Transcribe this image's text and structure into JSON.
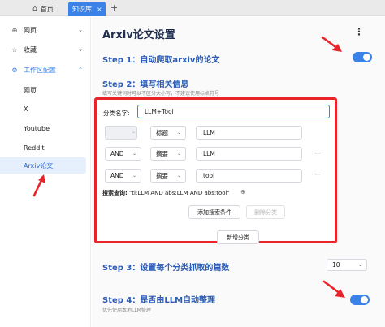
{
  "tabs": {
    "home_label": "首页",
    "active_label": "知识库",
    "close_glyph": "×",
    "add_glyph": "+"
  },
  "sidebar": {
    "items": [
      {
        "label": "网页",
        "icon": "globe-icon"
      },
      {
        "label": "收藏",
        "icon": "star-icon"
      },
      {
        "label": "工作区配置",
        "icon": "gear-icon"
      }
    ],
    "sub_items": [
      {
        "label": "网页"
      },
      {
        "label": "X"
      },
      {
        "label": "Youtube"
      },
      {
        "label": "Reddit"
      },
      {
        "label": "Arxiv论文",
        "active": true
      }
    ]
  },
  "main": {
    "title": "Arxiv论文设置",
    "kebab": "⋮",
    "step1": {
      "label": "Step 1：自动爬取arxiv的论文",
      "enabled": true
    },
    "step2": {
      "label": "Step 2：填写相关信息",
      "hint": "填写关键词时可以不区分大小写，不建议使用标点符号"
    },
    "category": {
      "label": "分类名字:",
      "value": "LLM+Tool"
    },
    "rows": [
      {
        "op": "",
        "field": "标题",
        "value": "LLM",
        "dash": ""
      },
      {
        "op": "AND",
        "field": "摘要",
        "value": "LLM",
        "dash": "—"
      },
      {
        "op": "AND",
        "field": "摘要",
        "value": "tool",
        "dash": "—"
      }
    ],
    "query_label": "搜索查询:",
    "query_value": "\"ti:LLM AND abs:LLM AND abs:tool\"",
    "add_condition": "添加搜索条件",
    "delete_category": "删除分类",
    "new_category": "新增分类",
    "step3": {
      "label": "Step 3：设置每个分类抓取的篇数",
      "value": "10"
    },
    "step4": {
      "label": "Step 4：是否由LLM自动整理",
      "hint": "优先使用本地LLM整理",
      "enabled": true
    }
  },
  "colors": {
    "accent": "#3b82e8",
    "highlight_red": "#e8232a"
  }
}
